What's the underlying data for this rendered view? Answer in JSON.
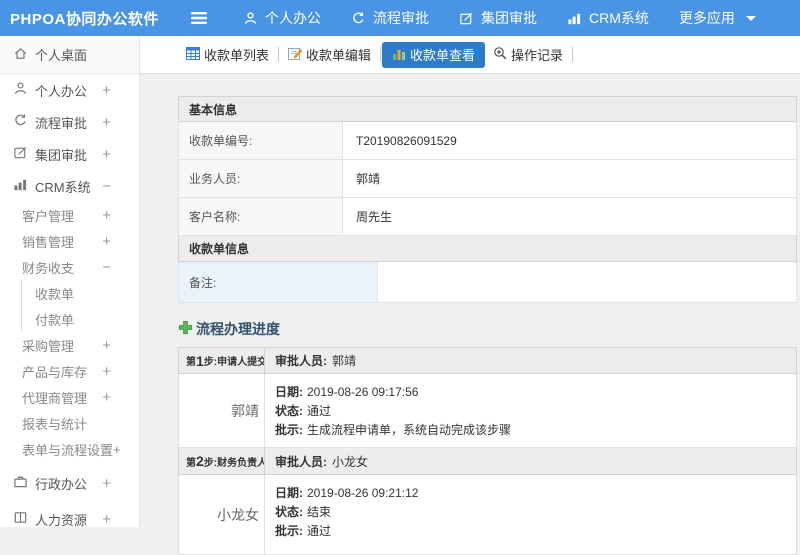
{
  "colors": {
    "topbar_blue": "#4a94e6",
    "active_tab_blue": "#2e7cc9",
    "plus_green": "#5cb85c",
    "remark_bg": "#eaf3fb",
    "section_header_bg": "#ececec"
  },
  "topbar": {
    "brand": "PHPOA协同办公软件",
    "menu": [
      {
        "label": "个人办公",
        "icon": "person-icon"
      },
      {
        "label": "流程审批",
        "icon": "process-icon"
      },
      {
        "label": "集团审批",
        "icon": "edit-icon"
      },
      {
        "label": "CRM系统",
        "icon": "chart-icon"
      },
      {
        "label": "更多应用",
        "icon": "caret-down-icon"
      }
    ]
  },
  "sidebar": {
    "items": [
      {
        "label": "个人桌面",
        "icon": "home-icon",
        "expander": ""
      },
      {
        "label": "个人办公",
        "icon": "person-icon",
        "expander": "+"
      },
      {
        "label": "流程审批",
        "icon": "process-icon",
        "expander": "+"
      },
      {
        "label": "集团审批",
        "icon": "edit-icon",
        "expander": "+"
      },
      {
        "label": "CRM系统",
        "icon": "chart-icon",
        "expander": "−"
      },
      {
        "label": "客户管理",
        "expander": "+"
      },
      {
        "label": "销售管理",
        "expander": "+"
      },
      {
        "label": "财务收支",
        "expander": "−"
      },
      {
        "label": "收款单",
        "expander": ""
      },
      {
        "label": "付款单",
        "expander": ""
      },
      {
        "label": "采购管理",
        "expander": "+"
      },
      {
        "label": "产品与库存",
        "expander": "+"
      },
      {
        "label": "代理商管理",
        "expander": "+"
      },
      {
        "label": "报表与统计",
        "expander": ""
      },
      {
        "label": "表单与流程设置",
        "expander": "+"
      },
      {
        "label": "行政办公",
        "icon": "briefcase-icon",
        "expander": "+"
      },
      {
        "label": "人力资源",
        "icon": "book-icon",
        "expander": "+"
      }
    ]
  },
  "tabs": [
    {
      "label": "收款单列表",
      "icon": "list-icon",
      "active": false
    },
    {
      "label": "收款单编辑",
      "icon": "edit-doc-icon",
      "active": false
    },
    {
      "label": "收款单查看",
      "icon": "view-chart-icon",
      "active": true
    },
    {
      "label": "操作记录",
      "icon": "zoom-in-icon",
      "active": false
    }
  ],
  "basic_info": {
    "title": "基本信息",
    "rows": [
      {
        "label": "收款单编号:",
        "value": "T20190826091529"
      },
      {
        "label": "业务人员:",
        "value": "郭靖"
      },
      {
        "label": "客户名称:",
        "value": "周先生"
      }
    ]
  },
  "receipt_info": {
    "title": "收款单信息",
    "remark_label": "备注:",
    "remark_value": ""
  },
  "process": {
    "heading": "流程办理进度",
    "steps": [
      {
        "prefix": "第",
        "number": "1",
        "suffix": "步:申请人提交申请",
        "approver_label": "审批人员:",
        "approver": "郭靖",
        "name": "郭靖",
        "lines": [
          {
            "label": "日期:",
            "value": "2019-08-26 09:17:56"
          },
          {
            "label": "状态:",
            "value": "通过"
          },
          {
            "label": "批示:",
            "value": "生成流程申请单，系统自动完成该步骤"
          }
        ]
      },
      {
        "prefix": "第",
        "number": "2",
        "suffix": "步:财务负责人审批",
        "approver_label": "审批人员:",
        "approver": "小龙女",
        "name": "小龙女",
        "lines": [
          {
            "label": "日期:",
            "value": "2019-08-26 09:21:12"
          },
          {
            "label": "状态:",
            "value": "结束"
          },
          {
            "label": "批示:",
            "value": "通过"
          }
        ]
      }
    ]
  }
}
